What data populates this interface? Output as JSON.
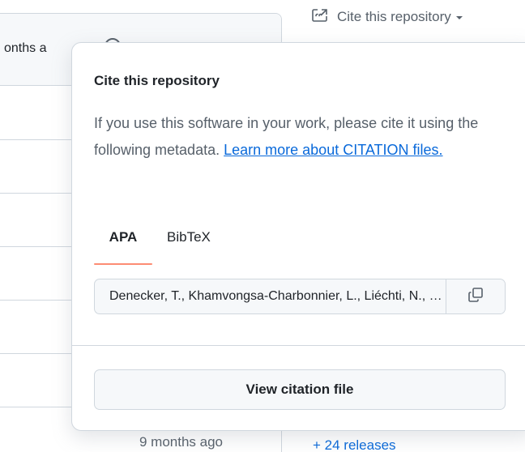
{
  "background": {
    "header_time": "onths a",
    "bottom_time": "9 months ago",
    "releases_link": "+ 24 releases"
  },
  "cite_trigger": {
    "label": "Cite this repository",
    "icon": "quote-external-icon"
  },
  "popover": {
    "title": "Cite this repository",
    "description": "If you use this software in your work, please cite it using the following metadata.",
    "learn_more_link": "Learn more about CITATION files.",
    "tabs": [
      {
        "label": "APA",
        "selected": true
      },
      {
        "label": "BibTeX",
        "selected": false
      }
    ],
    "citation_value": "Denecker, T., Khamvongsa-Charbonnier, L., Liéchti, N., Ferraro, K., Kierczak, M., Hetter, S. & Thierry, A.",
    "copy_icon": "copy-icon",
    "view_button_label": "View citation file"
  },
  "colors": {
    "accent_underline": "#fd8c73",
    "link": "#0969da",
    "border": "#d0d7de",
    "muted_text": "#57606a"
  }
}
